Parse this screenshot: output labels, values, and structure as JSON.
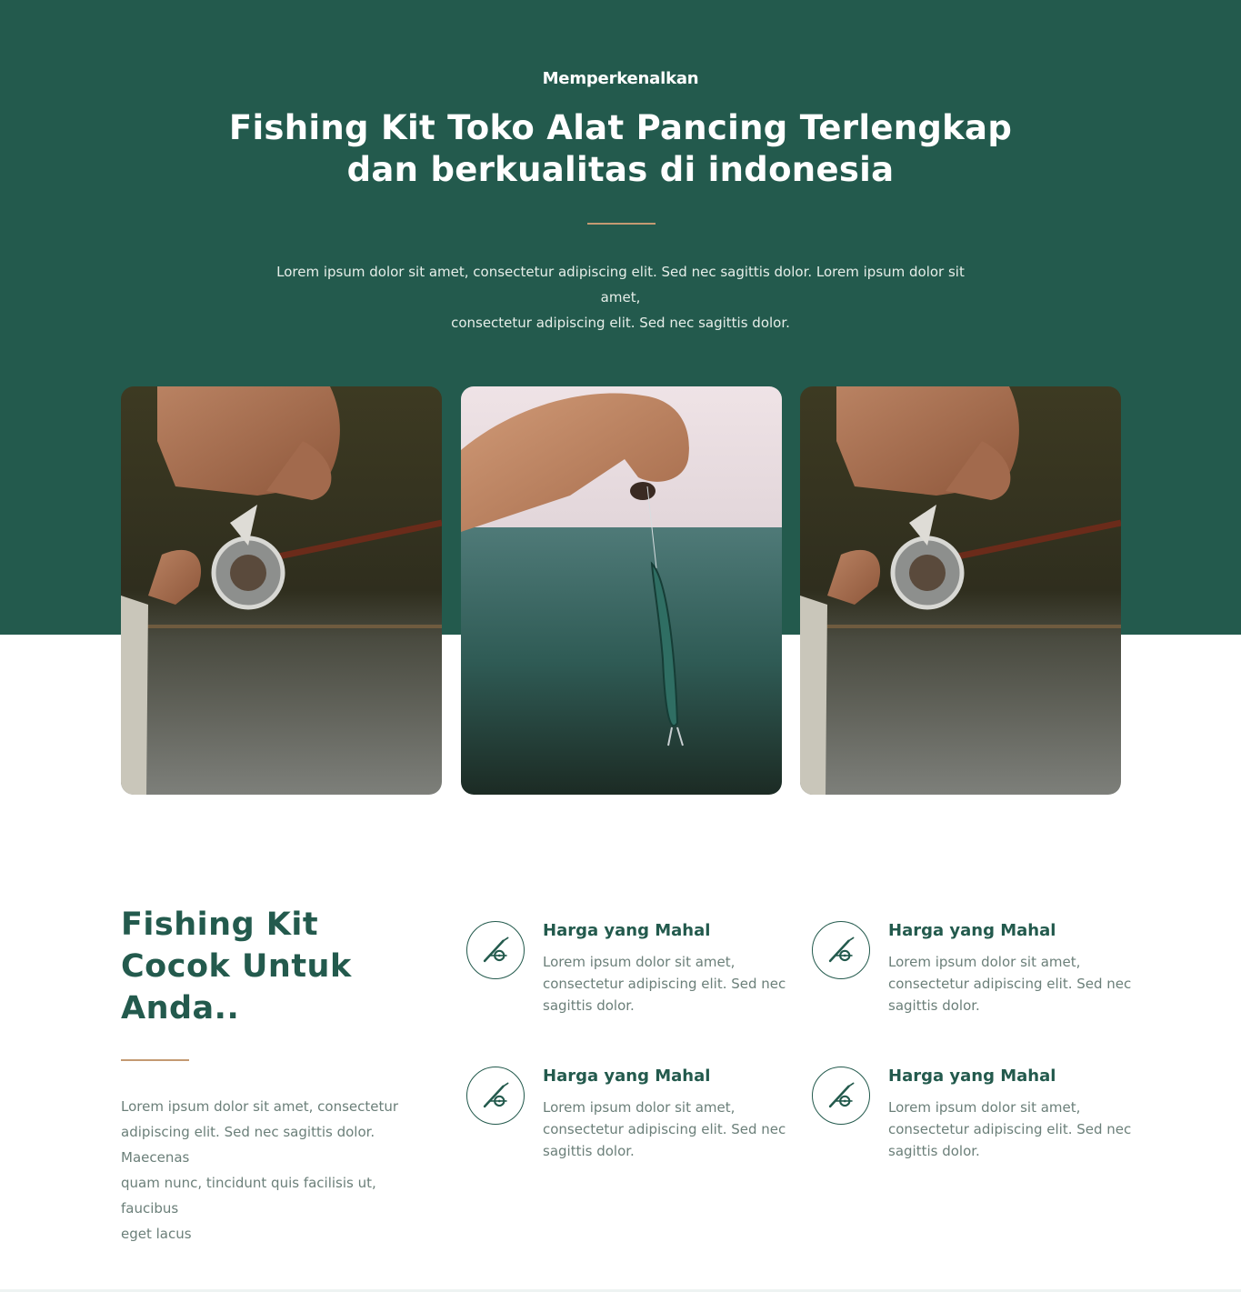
{
  "colors": {
    "primary_green": "#235a4d",
    "accent_copper": "#c49a72",
    "body_text_gray": "#6b7f79",
    "white": "#ffffff"
  },
  "hero": {
    "eyebrow": "Memperkenalkan",
    "title_line_1": "Fishing Kit Toko Alat Pancing Terlengkap",
    "title_line_2": "dan berkualitas di indonesia",
    "description_line_1": "Lorem ipsum dolor sit amet, consectetur adipiscing elit. Sed nec sagittis dolor. Lorem ipsum dolor sit amet,",
    "description_line_2": "consectetur adipiscing elit. Sed nec sagittis dolor."
  },
  "gallery": {
    "images": [
      {
        "icon": "fishing-reel-photo"
      },
      {
        "icon": "fishing-lure-over-sea-photo"
      },
      {
        "icon": "fishing-reel-photo"
      }
    ]
  },
  "features": {
    "title_line_1": "Fishing Kit",
    "title_line_2": "Cocok Untuk",
    "title_line_3": "Anda..",
    "description_line_1": "Lorem ipsum dolor sit amet, consectetur",
    "description_line_2": "adipiscing elit. Sed nec sagittis dolor. Maecenas",
    "description_line_3": "quam nunc, tincidunt quis facilisis ut, faucibus",
    "description_line_4": "eget lacus",
    "cards": [
      {
        "icon": "fishing-rod-icon",
        "title": "Harga yang Mahal",
        "text_line_1": "Lorem ipsum dolor sit amet,",
        "text_line_2": "consectetur adipiscing elit. Sed nec",
        "text_line_3": "sagittis dolor."
      },
      {
        "icon": "fishing-rod-icon",
        "title": "Harga yang Mahal",
        "text_line_1": "Lorem ipsum dolor sit amet,",
        "text_line_2": "consectetur adipiscing elit. Sed nec",
        "text_line_3": "sagittis dolor."
      },
      {
        "icon": "fishing-rod-icon",
        "title": "Harga yang Mahal",
        "text_line_1": "Lorem ipsum dolor sit amet,",
        "text_line_2": "consectetur adipiscing elit. Sed nec",
        "text_line_3": "sagittis dolor."
      },
      {
        "icon": "fishing-rod-icon",
        "title": "Harga yang Mahal",
        "text_line_1": "Lorem ipsum dolor sit amet,",
        "text_line_2": "consectetur adipiscing elit. Sed nec",
        "text_line_3": "sagittis dolor."
      }
    ]
  }
}
